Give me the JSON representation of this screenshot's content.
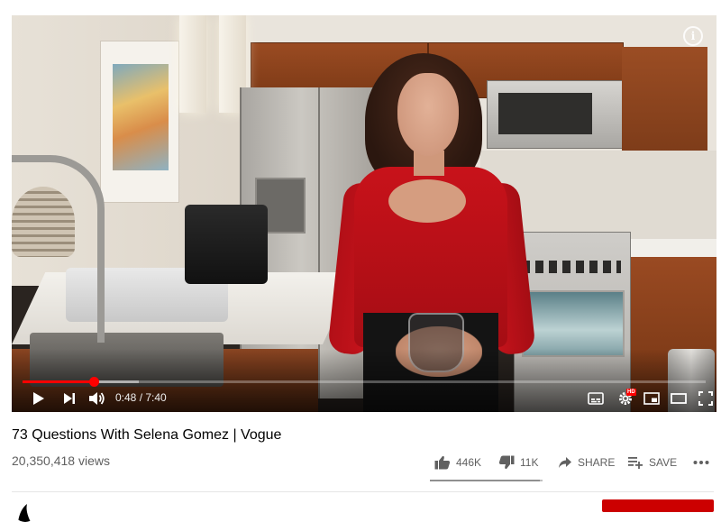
{
  "player": {
    "current_time": "0:48",
    "duration": "7:40",
    "time_display": "0:48 / 7:40",
    "progress_fraction": 0.104,
    "buffered_fraction": 0.17,
    "hd_badge": "HD",
    "icons": {
      "info": "info-icon",
      "play": "play-icon",
      "next": "next-icon",
      "volume": "volume-icon",
      "subtitles": "subtitles-icon",
      "settings": "settings-gear-icon",
      "miniplayer": "miniplayer-icon",
      "theater": "theater-mode-icon",
      "fullscreen": "fullscreen-icon"
    }
  },
  "video": {
    "title": "73 Questions With Selena Gomez | Vogue",
    "views": "20,350,418 views"
  },
  "actions": {
    "like_count": "446K",
    "dislike_count": "11K",
    "share_label": "SHARE",
    "save_label": "SAVE",
    "like_ratio": 0.976
  },
  "colors": {
    "progress": "#ff0000",
    "subscribe": "#cc0000",
    "secondary_text": "#606060"
  }
}
